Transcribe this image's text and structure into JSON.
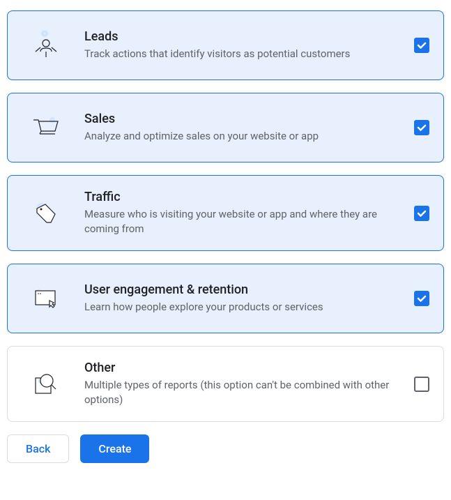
{
  "options": [
    {
      "id": "leads",
      "title": "Leads",
      "description": "Track actions that identify visitors as potential customers",
      "icon": "leads-icon",
      "selected": true
    },
    {
      "id": "sales",
      "title": "Sales",
      "description": "Analyze and optimize sales on your website or app",
      "icon": "sales-icon",
      "selected": true
    },
    {
      "id": "traffic",
      "title": "Traffic",
      "description": "Measure who is visiting your website or app and where they are coming from",
      "icon": "traffic-icon",
      "selected": true
    },
    {
      "id": "engagement",
      "title": "User engagement & retention",
      "description": "Learn how people explore your products or services",
      "icon": "engagement-icon",
      "selected": true
    },
    {
      "id": "other",
      "title": "Other",
      "description": "Multiple types of reports (this option can't be combined with other options)",
      "icon": "other-icon",
      "selected": false
    }
  ],
  "buttons": {
    "back": "Back",
    "create": "Create"
  },
  "colors": {
    "primary": "#1a73e8",
    "selectedBg": "#e8f0fd",
    "border": "#dadce0",
    "textPrimary": "#202124",
    "textSecondary": "#5f6368"
  }
}
